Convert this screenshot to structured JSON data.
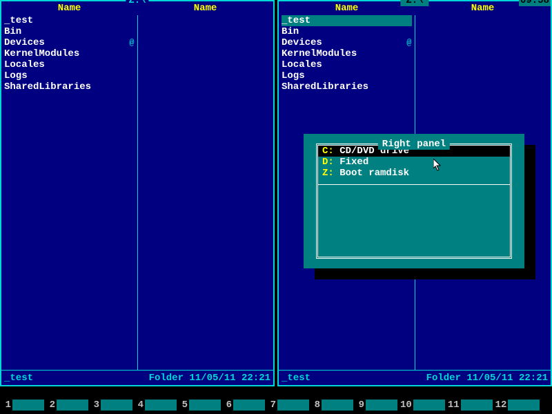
{
  "clock": "09:58",
  "left_panel": {
    "path": "Z:\\",
    "col_header": "Name",
    "items": [
      "_test",
      "Bin",
      "Devices",
      "KernelModules",
      "Locales",
      "Logs",
      "SharedLibraries"
    ],
    "device_link_index": 2,
    "status_name": "_test",
    "status_info": "Folder 11/05/11 22:21",
    "active": false
  },
  "right_panel": {
    "path": "Z:\\",
    "col_header": "Name",
    "items": [
      "_test",
      "Bin",
      "Devices",
      "KernelModules",
      "Locales",
      "Logs",
      "SharedLibraries"
    ],
    "device_link_index": 2,
    "selected_index": 0,
    "status_name": "_test",
    "status_info": "Folder 11/05/11 22:21",
    "active": true
  },
  "popup": {
    "title": "Right panel",
    "drives": [
      {
        "letter": "C:",
        "desc": "CD/DVD drive",
        "highlight": true
      },
      {
        "letter": "D:",
        "desc": "Fixed",
        "highlight": false
      },
      {
        "letter": "Z:",
        "desc": "Boot ramdisk",
        "highlight": false
      }
    ]
  },
  "fkeys": [
    "1",
    "2",
    "3",
    "4",
    "5",
    "6",
    "7",
    "8",
    "9",
    "10",
    "11",
    "12"
  ]
}
